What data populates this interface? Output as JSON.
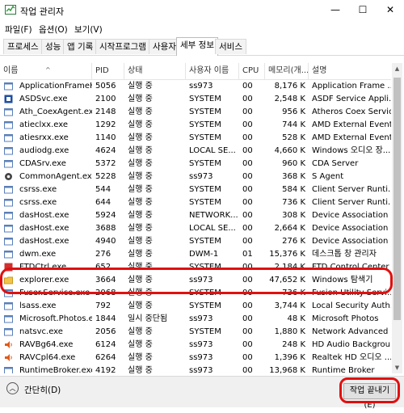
{
  "window": {
    "title": "작업 관리자",
    "minimize": "—",
    "maximize": "☐",
    "close": "✕"
  },
  "menu": [
    "파일(F)",
    "옵션(O)",
    "보기(V)"
  ],
  "tabs": [
    "프로세스",
    "성능",
    "앱 기록",
    "시작프로그램",
    "사용자",
    "세부 정보",
    "서비스"
  ],
  "active_tab": "세부 정보",
  "columns": [
    "이름",
    "PID",
    "상태",
    "사용자 이름",
    "CPU",
    "메모리(개...",
    "설명"
  ],
  "rows": [
    {
      "name": "ApplicationFrameHo...",
      "pid": "5056",
      "status": "실행 중",
      "user": "ss973",
      "cpu": "00",
      "mem": "8,176 K",
      "desc": "Application Frame ...",
      "icon": "app"
    },
    {
      "name": "ASDSvc.exe",
      "pid": "2100",
      "status": "실행 중",
      "user": "SYSTEM",
      "cpu": "00",
      "mem": "2,548 K",
      "desc": "ASDF Service Appli...",
      "icon": "blue"
    },
    {
      "name": "Ath_CoexAgent.exe",
      "pid": "2148",
      "status": "실행 중",
      "user": "SYSTEM",
      "cpu": "00",
      "mem": "956 K",
      "desc": "Atheros Coex Servic...",
      "icon": "app"
    },
    {
      "name": "atieclxx.exe",
      "pid": "1292",
      "status": "실행 중",
      "user": "SYSTEM",
      "cpu": "00",
      "mem": "744 K",
      "desc": "AMD External Event...",
      "icon": "app"
    },
    {
      "name": "atiesrxx.exe",
      "pid": "1140",
      "status": "실행 중",
      "user": "SYSTEM",
      "cpu": "00",
      "mem": "528 K",
      "desc": "AMD External Event...",
      "icon": "app"
    },
    {
      "name": "audiodg.exe",
      "pid": "4624",
      "status": "실행 중",
      "user": "LOCAL SE...",
      "cpu": "00",
      "mem": "4,660 K",
      "desc": "Windows 오디오 장...",
      "icon": "app"
    },
    {
      "name": "CDASrv.exe",
      "pid": "5372",
      "status": "실행 중",
      "user": "SYSTEM",
      "cpu": "00",
      "mem": "960 K",
      "desc": "CDA Server",
      "icon": "app"
    },
    {
      "name": "CommonAgent.exe",
      "pid": "5228",
      "status": "실행 중",
      "user": "ss973",
      "cpu": "00",
      "mem": "368 K",
      "desc": "S Agent",
      "icon": "gear"
    },
    {
      "name": "csrss.exe",
      "pid": "544",
      "status": "실행 중",
      "user": "SYSTEM",
      "cpu": "00",
      "mem": "584 K",
      "desc": "Client Server Runti...",
      "icon": "app"
    },
    {
      "name": "csrss.exe",
      "pid": "644",
      "status": "실행 중",
      "user": "SYSTEM",
      "cpu": "00",
      "mem": "736 K",
      "desc": "Client Server Runti...",
      "icon": "app"
    },
    {
      "name": "dasHost.exe",
      "pid": "5924",
      "status": "실행 중",
      "user": "NETWORK...",
      "cpu": "00",
      "mem": "308 K",
      "desc": "Device Association ...",
      "icon": "app"
    },
    {
      "name": "dasHost.exe",
      "pid": "3688",
      "status": "실행 중",
      "user": "LOCAL SE...",
      "cpu": "00",
      "mem": "2,664 K",
      "desc": "Device Association ...",
      "icon": "app"
    },
    {
      "name": "dasHost.exe",
      "pid": "4940",
      "status": "실행 중",
      "user": "SYSTEM",
      "cpu": "00",
      "mem": "276 K",
      "desc": "Device Association ...",
      "icon": "app"
    },
    {
      "name": "dwm.exe",
      "pid": "276",
      "status": "실행 중",
      "user": "DWM-1",
      "cpu": "01",
      "mem": "15,376 K",
      "desc": "데스크톱 창 관리자",
      "icon": "app"
    },
    {
      "name": "FTDCtrl.exe",
      "pid": "652",
      "status": "실행 중",
      "user": "SYSTEM",
      "cpu": "00",
      "mem": "2,184 K",
      "desc": "FTD Control Center",
      "icon": "red"
    },
    {
      "name": "explorer.exe",
      "pid": "3664",
      "status": "실행 중",
      "user": "ss973",
      "cpu": "00",
      "mem": "47,652 K",
      "desc": "Windows 탐색기",
      "icon": "folder"
    },
    {
      "name": "Fuser.Service.exe",
      "pid": "2068",
      "status": "실행 중",
      "user": "SYSTEM",
      "cpu": "00",
      "mem": "736 K",
      "desc": "Fusion Utility Servi...",
      "icon": "app"
    },
    {
      "name": "lsass.exe",
      "pid": "792",
      "status": "실행 중",
      "user": "SYSTEM",
      "cpu": "00",
      "mem": "3,744 K",
      "desc": "Local Security Auth...",
      "icon": "app"
    },
    {
      "name": "Microsoft.Photos.exe",
      "pid": "1844",
      "status": "일시 중단됨",
      "user": "ss973",
      "cpu": "00",
      "mem": "48 K",
      "desc": "Microsoft Photos",
      "icon": "app"
    },
    {
      "name": "natsvc.exe",
      "pid": "2056",
      "status": "실행 중",
      "user": "SYSTEM",
      "cpu": "00",
      "mem": "1,880 K",
      "desc": "Network Advanced ...",
      "icon": "app"
    },
    {
      "name": "RAVBg64.exe",
      "pid": "6124",
      "status": "실행 중",
      "user": "ss973",
      "cpu": "00",
      "mem": "248 K",
      "desc": "HD Audio Backgrou...",
      "icon": "speaker"
    },
    {
      "name": "RAVCpl64.exe",
      "pid": "6264",
      "status": "실행 중",
      "user": "ss973",
      "cpu": "00",
      "mem": "1,396 K",
      "desc": "Realtek HD 오디오 ...",
      "icon": "speaker"
    },
    {
      "name": "RuntimeBroker.exe",
      "pid": "4192",
      "status": "실행 중",
      "user": "ss973",
      "cpu": "00",
      "mem": "13,968 K",
      "desc": "Runtime Broker",
      "icon": "app"
    }
  ],
  "footer": {
    "fewer_details": "간단히(D)",
    "end_task": "작업 끝내기(E)"
  },
  "colors": {
    "highlight": "#e01010",
    "tab_active_border": "#bcbcbc"
  }
}
